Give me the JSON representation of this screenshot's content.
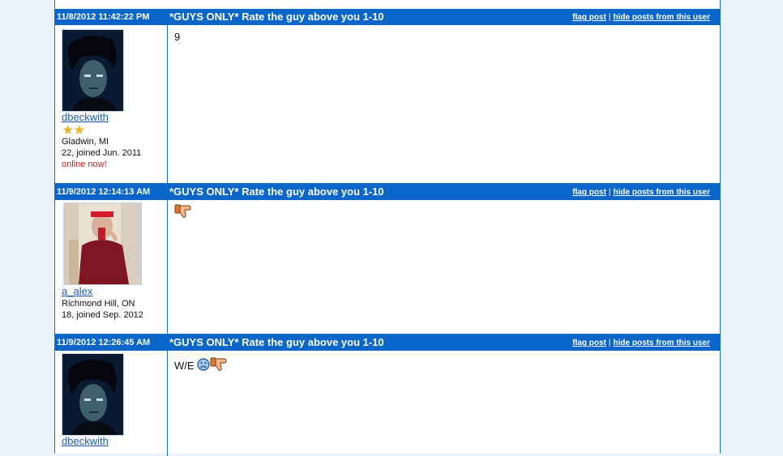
{
  "colors": {
    "page_bg": "#eaf2fb",
    "header_bg": "#0a66c8",
    "border": "#1f6fc6",
    "username": "#1a5fb4",
    "online": "#d81b1b",
    "stars": "#e8b830"
  },
  "posts": [
    {
      "date": "11/8/2012 11:42:22 PM",
      "title": "*GUYS ONLY* Rate the guy above you 1-10",
      "flag_label": "flag post",
      "hide_label": "hide posts from this user",
      "separator": "|",
      "user": {
        "name": "dbeckwith",
        "rating_stars": 2,
        "location": "Gladwin, MI",
        "info": "22, joined Jun. 2011",
        "status": "online now!"
      },
      "body": "9"
    },
    {
      "date": "11/9/2012 12:14:13 AM",
      "title": "*GUYS ONLY* Rate the guy above you 1-10",
      "flag_label": "flag post",
      "hide_label": "hide posts from this user",
      "separator": "|",
      "user": {
        "name": "a_alex",
        "location": "Richmond Hill, ON",
        "info": "18, joined Sep. 2012"
      },
      "body_icons": [
        "thumbs-down-icon"
      ]
    },
    {
      "date": "11/9/2012 12:26:45 AM",
      "title": "*GUYS ONLY* Rate the guy above you 1-10",
      "flag_label": "flag post",
      "hide_label": "hide posts from this user",
      "separator": "|",
      "user": {
        "name": "dbeckwith"
      },
      "body": "W/E",
      "body_icons": [
        "sad-face-icon",
        "thumbs-down-icon"
      ]
    }
  ]
}
